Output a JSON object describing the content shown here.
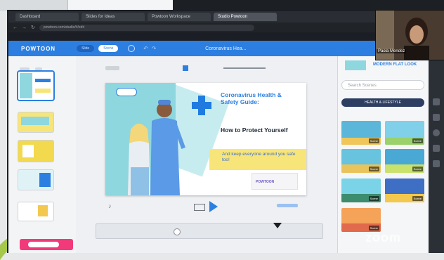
{
  "browser": {
    "tabs": [
      {
        "label": "Dashboard"
      },
      {
        "label": "Slides for Ideas"
      },
      {
        "label": "Powtoon Workspace"
      },
      {
        "label": "Studio Powtoon"
      }
    ],
    "url": "powtoon.com/studio/#/edit"
  },
  "app": {
    "logo": "POWTOON",
    "mode_pills": [
      "Slide",
      "Scene"
    ],
    "title": "Coronavirus Hea...",
    "accent": "#2c7fe1"
  },
  "slide": {
    "title": "Coronavirus Health & Safety Guide:",
    "subtitle": "How to Protect Yourself",
    "callout": "And keep everyone around you safe too!",
    "brand": "POWTOON"
  },
  "library": {
    "header": "MODERN FLAT LOOK",
    "search_placeholder": "Search Scenes",
    "category": "HEALTH & LIFESTYLE",
    "scene_tag": "Scene"
  },
  "call": {
    "participant": "Paola Mendez",
    "watermark": "zoom"
  },
  "colors": {
    "pink_button": "#f23a7a",
    "teal": "#8fd7df",
    "yellow": "#f7e57a"
  }
}
